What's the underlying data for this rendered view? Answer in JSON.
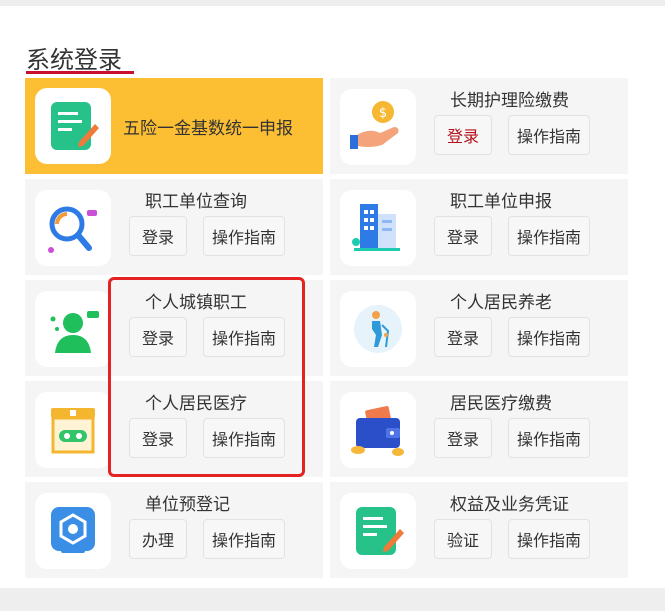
{
  "section_title": "系统登录",
  "tiles": [
    {
      "name": "五险一金基数统一申报",
      "icon": "form-pen-icon"
    },
    {
      "name": "长期护理险缴费",
      "icon": "coin-hand-icon",
      "btn1": "登录",
      "btn2": "操作指南"
    },
    {
      "name": "职工单位查询",
      "icon": "magnifier-icon",
      "btn1": "登录",
      "btn2": "操作指南"
    },
    {
      "name": "职工单位申报",
      "icon": "building-icon",
      "btn1": "登录",
      "btn2": "操作指南"
    },
    {
      "name": "个人城镇职工",
      "icon": "person-chat-icon",
      "btn1": "登录",
      "btn2": "操作指南"
    },
    {
      "name": "个人居民养老",
      "icon": "elderly-icon",
      "btn1": "登录",
      "btn2": "操作指南"
    },
    {
      "name": "个人居民医疗",
      "icon": "clinic-icon",
      "btn1": "登录",
      "btn2": "操作指南"
    },
    {
      "name": "居民医疗缴费",
      "icon": "wallet-icon",
      "btn1": "登录",
      "btn2": "操作指南"
    },
    {
      "name": "单位预登记",
      "icon": "hex-gear-icon",
      "btn1": "办理",
      "btn2": "操作指南"
    },
    {
      "name": "权益及业务凭证",
      "icon": "form-pen-icon",
      "btn1": "验证",
      "btn2": "操作指南"
    }
  ],
  "colors": {
    "featured": "#fcbf33",
    "accent_red": "#c8102e",
    "highlight": "#e42222",
    "tile_bg": "#f5f5f5"
  }
}
